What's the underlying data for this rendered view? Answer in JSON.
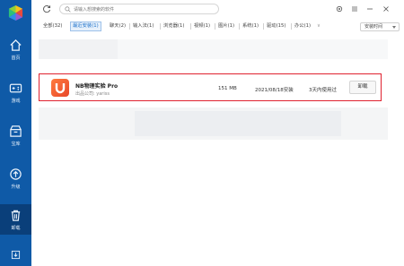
{
  "colors": {
    "sidebar": "#0f5aa7",
    "sidebar_active": "#0a3f7a",
    "accent": "#1a6fc9",
    "highlight_border": "#e0222f",
    "app_icon": "#e8482b"
  },
  "sidebar": {
    "items": [
      {
        "label": "首页",
        "icon": "home-icon"
      },
      {
        "label": "游戏",
        "icon": "gamepad-icon"
      },
      {
        "label": "宝库",
        "icon": "treasure-icon"
      },
      {
        "label": "升级",
        "icon": "upgrade-icon"
      },
      {
        "label": "卸载",
        "icon": "trash-icon"
      }
    ],
    "active": "卸载",
    "bottom_icon": "download-icon"
  },
  "titlebar": {
    "search_placeholder": "请输入想搜索的软件",
    "icons": [
      "refresh-icon",
      "search-icon",
      "settings-icon",
      "menu-icon",
      "minimize-icon",
      "close-icon"
    ]
  },
  "tabs": [
    {
      "label": "全部(32)"
    },
    {
      "label": "最近安装(1)",
      "active": true
    },
    {
      "label": "聊天(2)"
    },
    {
      "label": "输入法(1)"
    },
    {
      "label": "浏览器(1)"
    },
    {
      "label": "视频(1)"
    },
    {
      "label": "图片(1)"
    },
    {
      "label": "系统(1)"
    },
    {
      "label": "驱动(15)"
    },
    {
      "label": "办公(1)"
    }
  ],
  "sort": {
    "label": "安装时间"
  },
  "app": {
    "name": "NB物理实验 Pro",
    "publisher": "出品公司: yariss",
    "size": "151 MB",
    "date": "2021/08/18安装",
    "usage": "3天内使用过",
    "uninstall_label": "卸载"
  }
}
